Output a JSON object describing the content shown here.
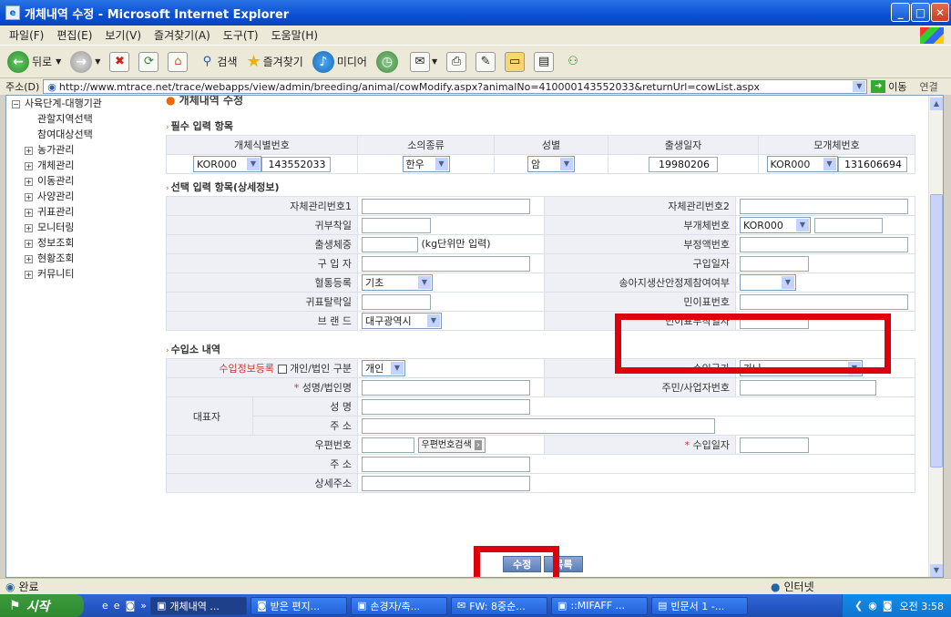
{
  "window": {
    "title": "개체내역 수정 - Microsoft Internet Explorer"
  },
  "menu": [
    "파일(F)",
    "편집(E)",
    "보기(V)",
    "즐겨찾기(A)",
    "도구(T)",
    "도움말(H)"
  ],
  "toolbar": {
    "back": "뒤로",
    "search": "검색",
    "favorites": "즐겨찾기",
    "media": "미디어"
  },
  "address": {
    "label": "주소(D)",
    "url": "http://www.mtrace.net/trace/webapps/view/admin/breeding/animal/cowModify.aspx?animalNo=410000143552033&returnUrl=cowList.aspx",
    "go": "이동",
    "links": "연결"
  },
  "sidebar": {
    "top": "사육단계-대행기관",
    "sub": [
      "관할지역선택",
      "참여대상선택"
    ],
    "items": [
      "농가관리",
      "개체관리",
      "이동관리",
      "사양관리",
      "귀표관리",
      "모니터링",
      "정보조회",
      "현황조회",
      "커뮤니티"
    ]
  },
  "page": {
    "title": "개체내역 수정"
  },
  "required": {
    "heading": "필수 입력 항목",
    "headers": [
      "개체식별번호",
      "소의종류",
      "성별",
      "출생일자",
      "모개체번호"
    ],
    "id_prefix": "KOR000",
    "id_number": "143552033",
    "breed": "한우",
    "sex": "암",
    "birth": "19980206",
    "mother_prefix": "KOR000",
    "mother_number": "131606694"
  },
  "optional": {
    "heading": "선택 입력 항목(상세정보)",
    "l1": "자체관리번호1",
    "r1": "자체관리번호2",
    "l2": "귀부착일",
    "r2": "부개체번호",
    "r2_prefix": "KOR000",
    "l3": "출생체중",
    "l3_hint": "(kg단위만 입력)",
    "r3": "부정액번호",
    "l4": "구 입 자",
    "r4": "구입일자",
    "l5": "혈통등록",
    "l5_value": "기초",
    "r5": "송아지생산안정제참여여부",
    "l6": "귀표탈락일",
    "r6": "민이표번호",
    "l7": "브 랜 드",
    "l7_value": "대구광역시",
    "r7": "민이표부착일자"
  },
  "import": {
    "heading": "수입소 내역",
    "reg_label": "수입정보등록",
    "type_label": "개인/법인 구분",
    "type_value": "개인",
    "country_label": "수입국가",
    "country_value": "가나",
    "name_label": "성명/법인명",
    "reg_no_label": "주민/사업자번호",
    "rep_label": "대표자",
    "rep_name": "성 명",
    "rep_addr": "주 소",
    "zip_label": "우편번호",
    "zip_btn": "우편번호검색",
    "date_label": "수입일자",
    "addr_label": "주 소",
    "detail_label": "상세주소",
    "star": "*"
  },
  "buttons": {
    "save": "수정",
    "list": "목록"
  },
  "status": {
    "left": "완료",
    "zone": "인터넷"
  },
  "taskbar": {
    "start": "시작",
    "tasks": [
      "개체내역 ...",
      "받은 편지...",
      "손경자/축...",
      "FW: 8중순...",
      "::MIFAFF ...",
      "빈문서 1 -..."
    ],
    "clock": "오전 3:58"
  }
}
